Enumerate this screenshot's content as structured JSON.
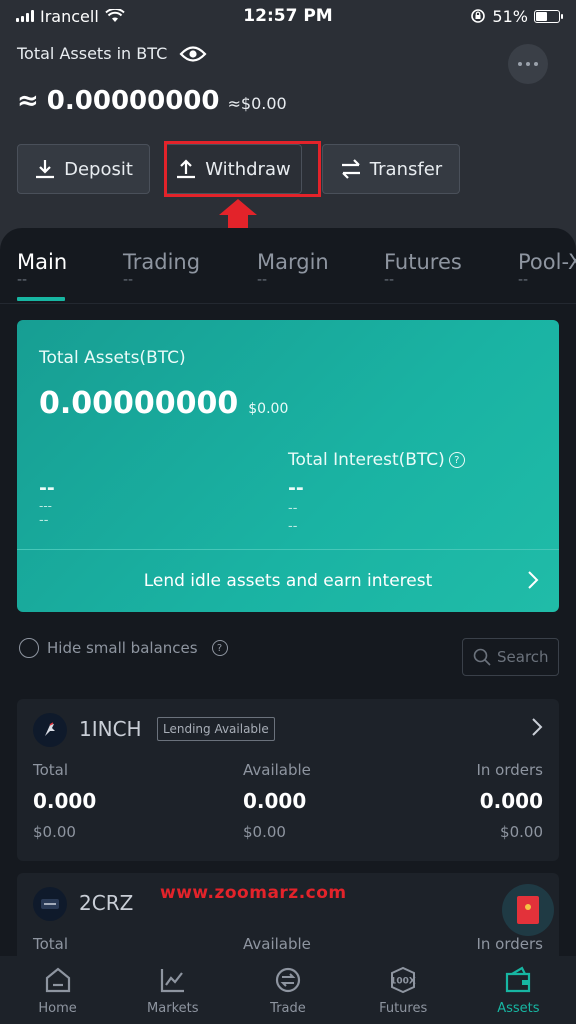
{
  "status_bar": {
    "carrier": "Irancell",
    "time": "12:57 PM",
    "battery": "51%",
    "battery_level": 0.51
  },
  "header": {
    "assets_label": "Total Assets in BTC",
    "btc_prefix": "≈",
    "btc_value": "0.00000000",
    "usd_value": "≈$0.00"
  },
  "actions": {
    "deposit": "Deposit",
    "withdraw": "Withdraw",
    "transfer": "Transfer"
  },
  "tabs": [
    {
      "label": "Main",
      "sub": "--"
    },
    {
      "label": "Trading",
      "sub": "--"
    },
    {
      "label": "Margin",
      "sub": "--"
    },
    {
      "label": "Futures",
      "sub": "--"
    },
    {
      "label": "Pool-X",
      "sub": "--"
    }
  ],
  "main_card": {
    "title": "Total Assets(BTC)",
    "value": "0.00000000",
    "usd": "$0.00",
    "interest_label": "Total Interest(BTC)",
    "left_d1": "--",
    "left_d2": "---",
    "left_d3": "--",
    "right_d1": "--",
    "right_d2": "--",
    "right_d3": "--",
    "lend_text": "Lend idle assets and earn interest"
  },
  "filter": {
    "hide_small": "Hide small balances",
    "search_placeholder": "Search"
  },
  "assets": [
    {
      "name": "1INCH",
      "badge": "Lending Available",
      "total_label": "Total",
      "available_label": "Available",
      "orders_label": "In orders",
      "total": "0.000",
      "available": "0.000",
      "orders": "0.000",
      "total_usd": "$0.00",
      "available_usd": "$0.00",
      "orders_usd": "$0.00"
    },
    {
      "name": "2CRZ",
      "total_label": "Total",
      "available_label": "Available",
      "orders_label": "In orders"
    }
  ],
  "watermark": "www.zoomarz.com",
  "nav": [
    {
      "label": "Home",
      "icon": "home-icon"
    },
    {
      "label": "Markets",
      "icon": "chart-icon"
    },
    {
      "label": "Trade",
      "icon": "trade-icon"
    },
    {
      "label": "Futures",
      "icon": "futures-100x-icon"
    },
    {
      "label": "Assets",
      "icon": "wallet-icon"
    }
  ],
  "colors": {
    "accent": "#17b6a2",
    "highlight": "#e3232a",
    "background": "#15191f"
  }
}
